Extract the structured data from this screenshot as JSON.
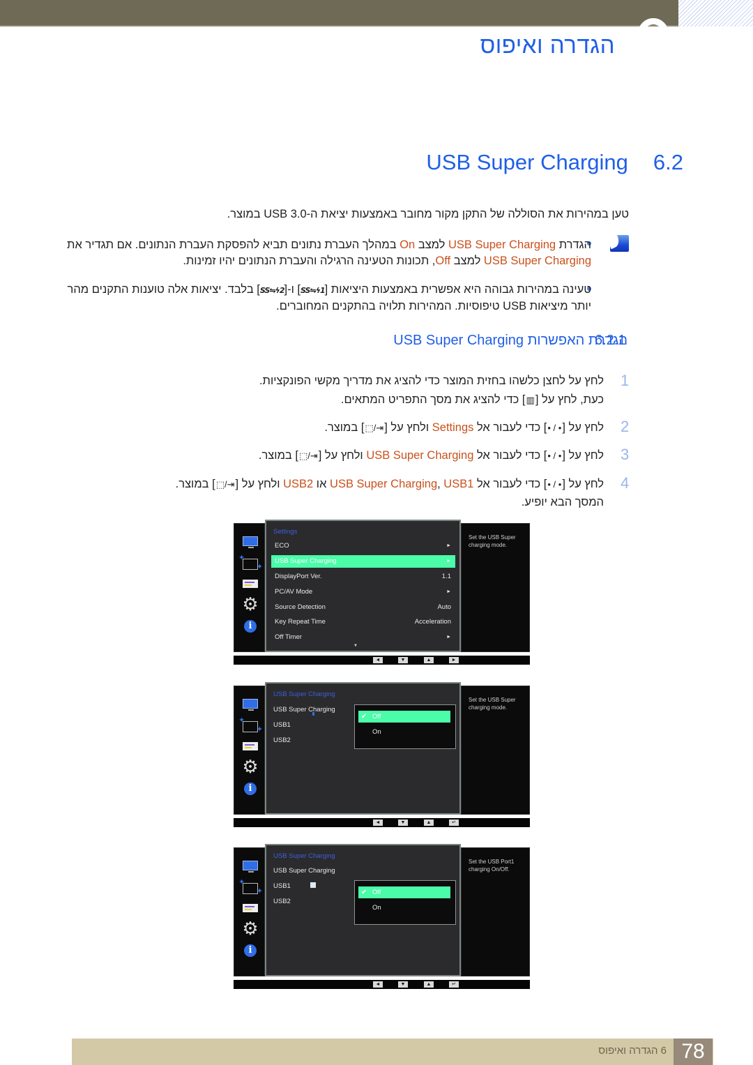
{
  "header": {
    "chapter_title": "הגדרה ואיפוס"
  },
  "section": {
    "number": "6.2",
    "title": "USB Super Charging"
  },
  "intro": "טען במהירות את הסוללה של התקן מקור מחובר באמצעות יציאת ה-USB 3.0 במוצר.",
  "notes": {
    "icon": "note-icon",
    "bullet1": {
      "p1": "הגדרת ",
      "o1": "USB Super Charging",
      "p2": " למצב ",
      "o2": "On",
      "p3": " במהלך העברת נתונים תביא להפסקת העברת הנתונים. אם תגדיר את ",
      "o3": "USB Super Charging",
      "p4": " למצב ",
      "o4": "Off",
      "p5": ", תכונות הטעינה הרגילה והעברת הנתונים יהיו זמינות."
    },
    "bullet2": {
      "p1": "טעינה במהירות גבוהה היא אפשרית באמצעות היציאות [",
      "port1": "SS⇋ϟ1",
      "p2": "] ו-[",
      "port2": "SS⇋ϟ2",
      "p3": "] בלבד. יציאות אלה טוענות התקנים מהר יותר מיציאות USB טיפוסיות. המהירות תלויה בהתקנים המחוברים."
    }
  },
  "subsection": {
    "number": "6.2.1",
    "title": "הגדרת האפשרות USB Super Charging"
  },
  "steps": [
    {
      "num": "1",
      "line1": "לחץ על לחצן כלשהו בחזית המוצר כדי להציג את מדריך מקשי הפונקציות.",
      "line2_a": "כעת, לחץ על [",
      "line2_key": "▥",
      "line2_b": "] כדי להציג את מסך התפריט המתאים."
    },
    {
      "num": "2",
      "a": "לחץ על [",
      "nav": "• / •",
      "b": "] כדי לעבור אל ",
      "target": "Settings",
      "c": " ולחץ על [",
      "enter": "⇥/⬚",
      "d": "] במוצר."
    },
    {
      "num": "3",
      "a": "לחץ על [",
      "nav": "• / •",
      "b": "] כדי לעבור אל ",
      "target": "USB Super Charging",
      "c": " ולחץ על [",
      "enter": "⇥/⬚",
      "d": "] במוצר."
    },
    {
      "num": "4",
      "a": "לחץ על [",
      "nav": "• / •",
      "b": "] כדי לעבור אל ",
      "target": "USB Super Charging",
      "sep1": ", ",
      "target2": "USB1",
      "or": " או ",
      "target3": "USB2",
      "c": " ולחץ על [",
      "enter": "⇥/⬚",
      "d": "] במוצר.",
      "line2": "המסך הבא יופיע."
    }
  ],
  "osd1": {
    "title": "Settings",
    "items": [
      {
        "label": "ECO",
        "value": "",
        "arrow": "►"
      },
      {
        "label": "USB Super Charging",
        "value": "",
        "arrow": "►",
        "selected": true
      },
      {
        "label": "DisplayPort Ver.",
        "value": "1.1",
        "arrow": ""
      },
      {
        "label": "PC/AV Mode",
        "value": "",
        "arrow": "►"
      },
      {
        "label": "Source Detection",
        "value": "Auto",
        "arrow": ""
      },
      {
        "label": "Key Repeat Time",
        "value": "Acceleration",
        "arrow": ""
      },
      {
        "label": "Off Timer",
        "value": "",
        "arrow": "►"
      }
    ],
    "scroll_indicator": "▼",
    "help": "Set the USB Super charging mode.",
    "nav_keys": [
      "◄",
      "▼",
      "▲",
      "►"
    ]
  },
  "osd2": {
    "title": "USB Super Charging",
    "items": [
      "USB Super Charging",
      "USB1",
      "USB2"
    ],
    "options": [
      {
        "label": "Off",
        "selected": true
      },
      {
        "label": "On",
        "selected": false
      }
    ],
    "check": "✔",
    "help": "Set the USB Super charging mode.",
    "nav_keys": [
      "◄",
      "▼",
      "▲",
      "↵"
    ]
  },
  "osd3": {
    "title": "USB Super Charging",
    "items": [
      "USB Super Charging",
      "USB1",
      "USB2"
    ],
    "options": [
      {
        "label": "Off",
        "selected": true
      },
      {
        "label": "On",
        "selected": false
      }
    ],
    "check": "✔",
    "help": "Set the USB Port1 charging On/Off.",
    "nav_keys": [
      "◄",
      "▼",
      "▲",
      "↵"
    ]
  },
  "osd_icons": [
    "monitor-icon",
    "position-icon",
    "pip-icon",
    "gear-icon",
    "info-icon"
  ],
  "footer": {
    "page_number": "78",
    "chapter_label": "6 הגדרה ואיפוס"
  }
}
